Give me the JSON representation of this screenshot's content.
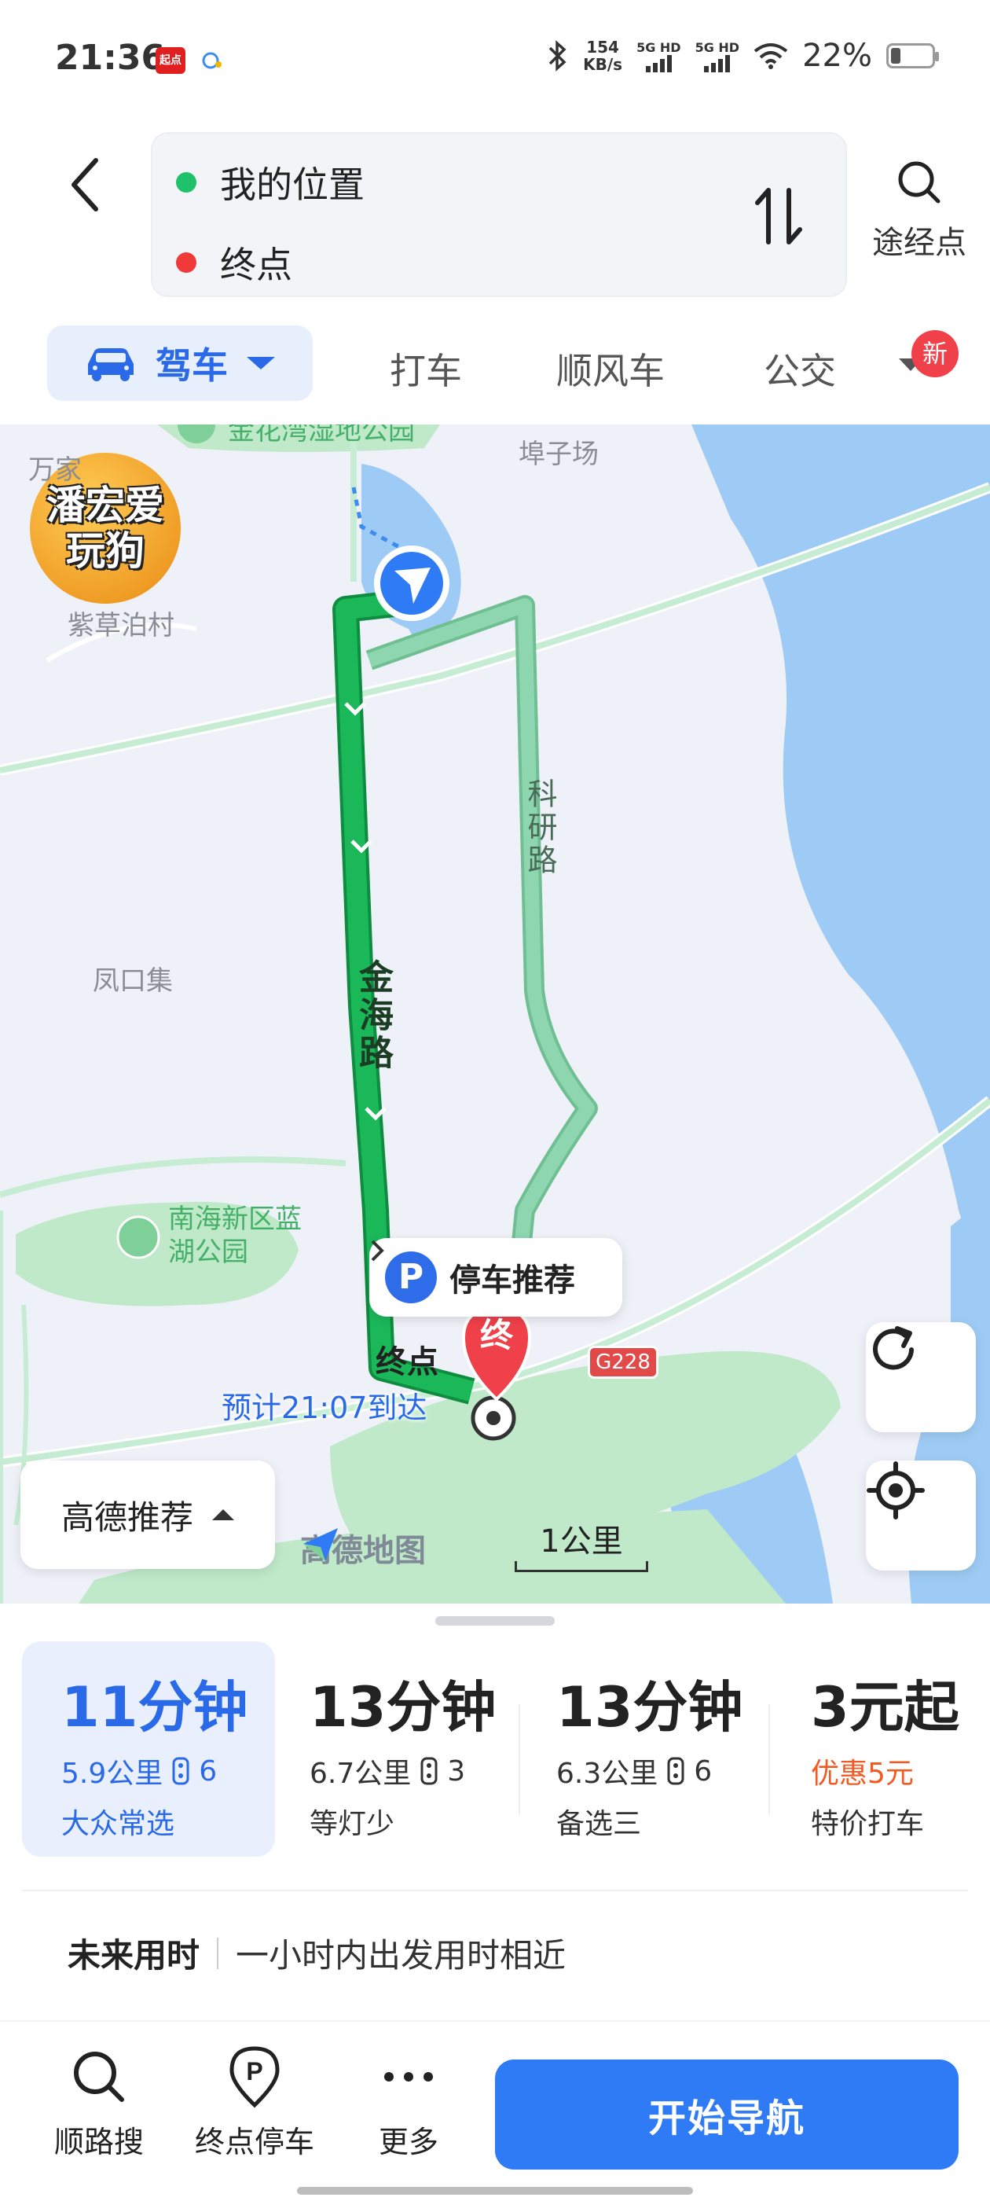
{
  "status_bar": {
    "time": "21:36",
    "app_badge_1": "起点",
    "net_speed_value": "154",
    "net_speed_unit": "KB/s",
    "sim1": "5G HD",
    "sim2": "5G HD",
    "battery": "22%"
  },
  "search": {
    "origin": "我的位置",
    "destination": "终点",
    "origin_color": "#1fc16b",
    "destination_color": "#f03a3a",
    "via_label": "途经点"
  },
  "modes": {
    "active": "驾车",
    "items": [
      "打车",
      "顺风车",
      "公交"
    ],
    "new_badge": "新"
  },
  "map": {
    "overlay_badge": "潘宏爱玩狗",
    "labels": {
      "park_top": "金花湾湿地公园",
      "fuzichang": "埠子场",
      "wanjia": "万家",
      "zicaobo": "紫草泊村",
      "fengkouji": "凤口集",
      "lanhu_park": "南海新区蓝湖公园"
    },
    "roads": {
      "main": "金海路",
      "side": "科研路"
    },
    "parking_recommend": "停车推荐",
    "end_label": "终点",
    "end_marker": "终",
    "eta": "预计21:07到达",
    "highway": "G228",
    "recommend_button": "高德推荐",
    "brand": "高德地图",
    "scale": "1公里",
    "route_color": "#1bb85a",
    "alt_route_color": "#8ed6b0",
    "water_color": "#9ecbf5",
    "park_color": "#bfe9c9"
  },
  "routes": [
    {
      "time": "11分钟",
      "distance": "5.9公里",
      "lights": "6",
      "tag": "大众常选"
    },
    {
      "time": "13分钟",
      "distance": "6.7公里",
      "lights": "3",
      "tag": "等灯少"
    },
    {
      "time": "13分钟",
      "distance": "6.3公里",
      "lights": "6",
      "tag": "备选三"
    },
    {
      "time": "3元起",
      "discount": "优惠5元",
      "tag": "特价打车"
    }
  ],
  "future": {
    "title": "未来用时",
    "description": "一小时内出发用时相近"
  },
  "bottom_nav": {
    "items": [
      "顺路搜",
      "终点停车",
      "更多"
    ],
    "start": "开始导航"
  }
}
